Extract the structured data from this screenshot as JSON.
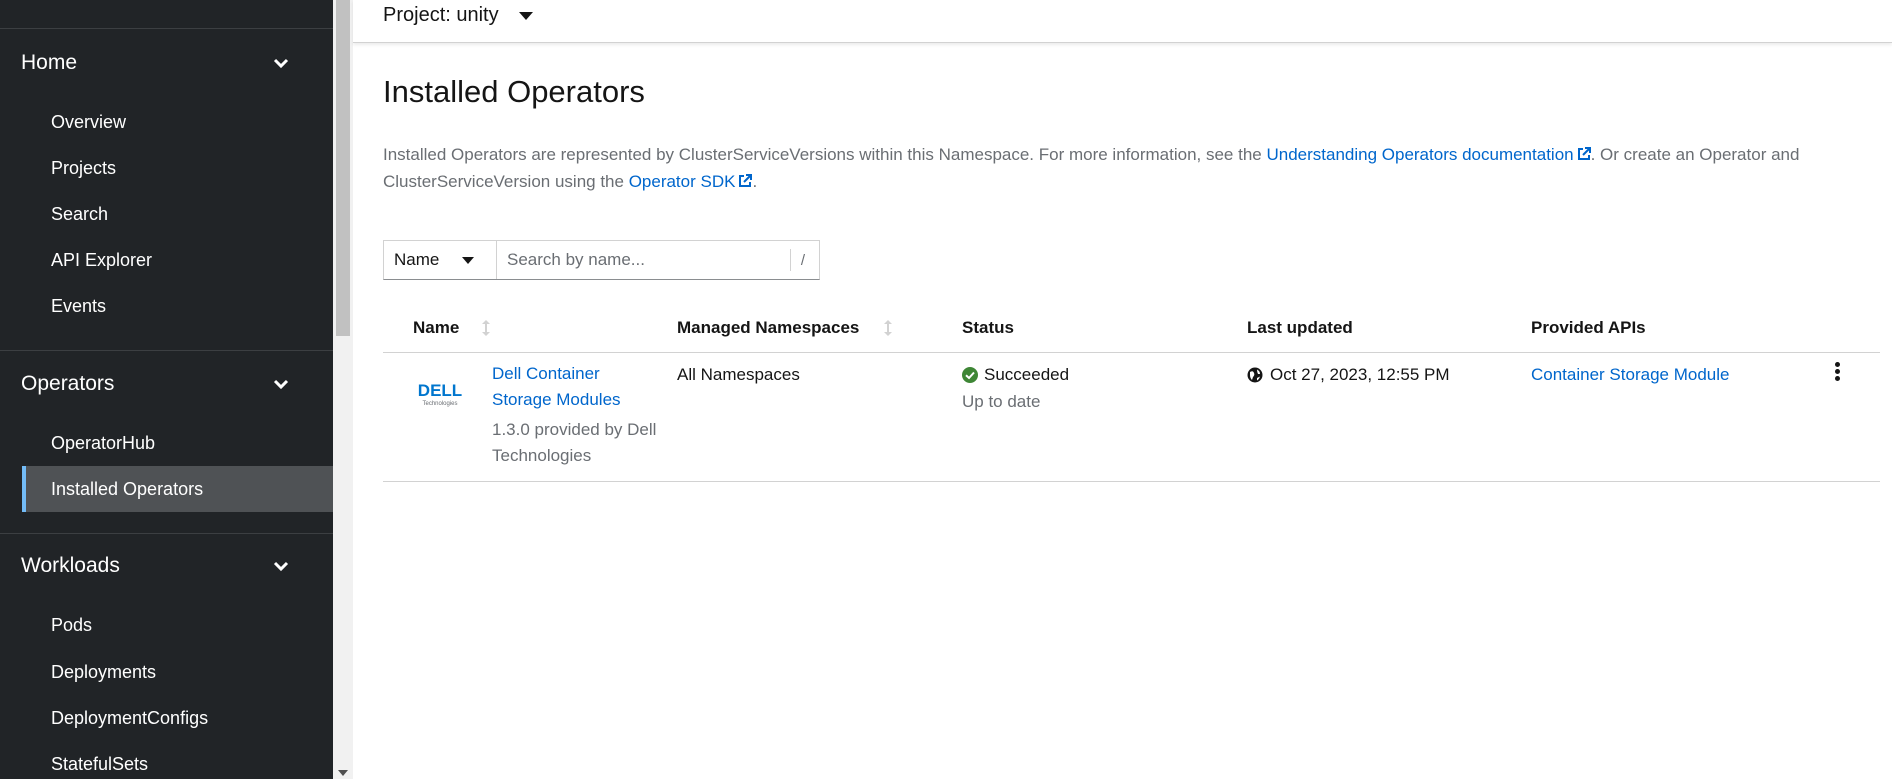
{
  "sidebar": {
    "groups": [
      {
        "label": "Home",
        "items": [
          {
            "label": "Overview"
          },
          {
            "label": "Projects"
          },
          {
            "label": "Search"
          },
          {
            "label": "API Explorer"
          },
          {
            "label": "Events"
          }
        ]
      },
      {
        "label": "Operators",
        "items": [
          {
            "label": "OperatorHub"
          },
          {
            "label": "Installed Operators",
            "active": true
          }
        ]
      },
      {
        "label": "Workloads",
        "items": [
          {
            "label": "Pods"
          },
          {
            "label": "Deployments"
          },
          {
            "label": "DeploymentConfigs"
          },
          {
            "label": "StatefulSets"
          }
        ]
      }
    ],
    "active_accent": "#73bcf7"
  },
  "project": {
    "label": "Project: unity"
  },
  "page": {
    "title": "Installed Operators",
    "description": {
      "part1": "Installed Operators are represented by ClusterServiceVersions within this Namespace. For more information, see the ",
      "link1": "Understanding Operators documentation",
      "part2": ". Or create an Operator and ClusterServiceVersion using the ",
      "link2": "Operator SDK",
      "part3": "."
    }
  },
  "filter": {
    "selected": "Name",
    "placeholder": "Search by name...",
    "shortcut": "/"
  },
  "table": {
    "columns": [
      "Name",
      "Managed Namespaces",
      "Status",
      "Last updated",
      "Provided APIs"
    ],
    "rows": [
      {
        "logo_text": "DELL",
        "logo_subtext": "Technologies",
        "name": "Dell Container Storage Modules",
        "name_line1": "Dell Container",
        "name_line2": "Storage Modules",
        "version_line1": "1.3.0 provided by Dell",
        "version_line2": "Technologies",
        "namespaces": "All Namespaces",
        "status": "Succeeded",
        "status_detail": "Up to date",
        "status_color": "#3e8635",
        "last_updated": "Oct 27, 2023, 12:55 PM",
        "provided_api": "Container Storage Module"
      }
    ]
  },
  "colors": {
    "link": "#0066cc",
    "sidebar_bg": "#212427",
    "dell_blue": "#0076ce"
  }
}
